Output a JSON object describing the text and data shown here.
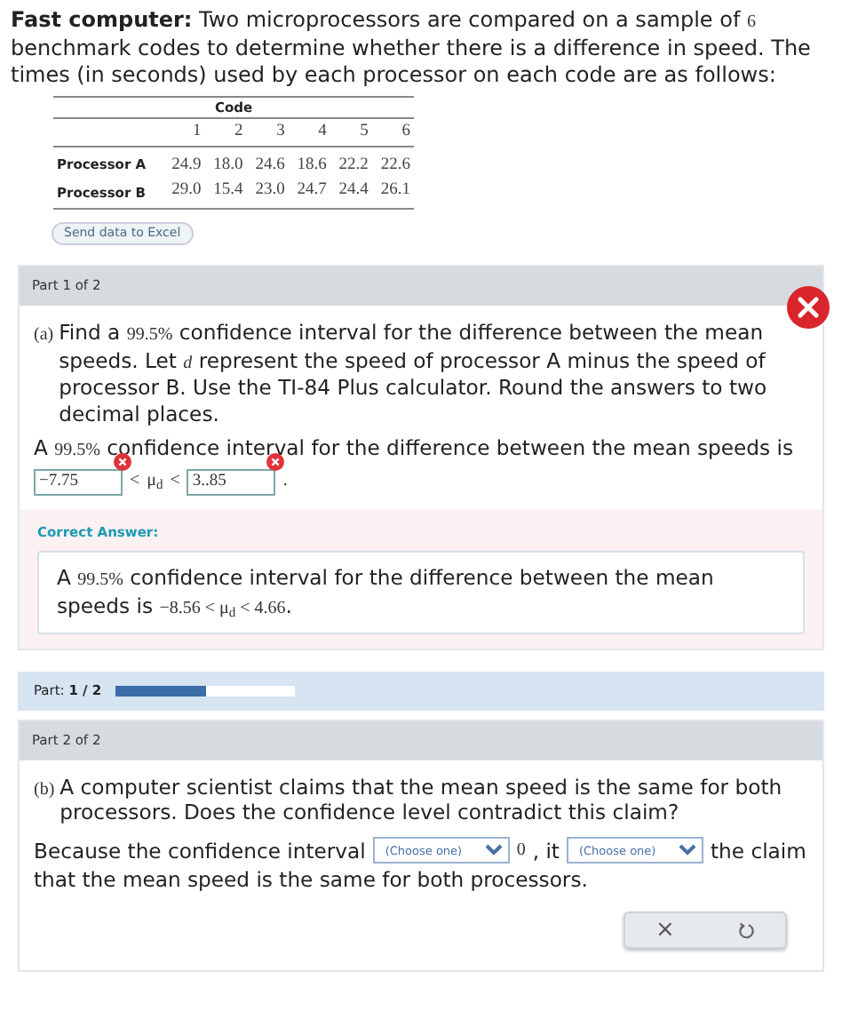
{
  "intro": [
    {
      "kind": "text",
      "text": "**Fast computer:** Two microprocessors are compared on a sample of "
    },
    {
      "kind": "math",
      "text": "6"
    },
    {
      "kind": "text",
      "text": " benchmark codes to determine whether there is a difference in speed. The times (in seconds) used by each processor on each code are as follows:"
    }
  ],
  "table": {
    "heading": "Code",
    "columns": [
      "1",
      "2",
      "3",
      "4",
      "5",
      "6"
    ],
    "rows": [
      {
        "label": "Processor A",
        "values": [
          "24.9",
          "18.0",
          "24.6",
          "18.6",
          "22.2",
          "22.6"
        ]
      },
      {
        "label": "Processor B",
        "values": [
          "29.0",
          "15.4",
          "23.0",
          "24.7",
          "24.4",
          "26.1"
        ]
      }
    ]
  },
  "excel_button": "Send data to Excel",
  "part1": {
    "header": "Part 1 of 2",
    "incorrect": true,
    "label": "(a)",
    "question": [
      {
        "kind": "text",
        "text": "Find a "
      },
      {
        "kind": "math",
        "text": "99.5%"
      },
      {
        "kind": "text",
        "text": " confidence interval for the difference between the mean speeds. Let "
      },
      {
        "kind": "math",
        "text": "*d*"
      },
      {
        "kind": "text",
        "text": " represent the speed of processor A minus the speed of processor B. Use the TI-84 Plus calculator. Round the answers to two decimal places."
      }
    ],
    "answer_intro": [
      {
        "kind": "text",
        "text": "A "
      },
      {
        "kind": "math",
        "text": "99.5%"
      },
      {
        "kind": "text",
        "text": " confidence interval for the difference between the mean speeds is"
      }
    ],
    "answer": [
      {
        "kind": "field",
        "value": "−7.75",
        "wrong": true
      },
      {
        "kind": "math",
        "text": "<"
      },
      {
        "kind": "math",
        "text": "μ$_{d}$"
      },
      {
        "kind": "math",
        "text": "<"
      },
      {
        "kind": "field",
        "value": "3..85",
        "wrong": true
      },
      {
        "kind": "math",
        "text": "."
      }
    ],
    "correct_label": "Correct Answer:",
    "correct": [
      {
        "kind": "text",
        "text": "A "
      },
      {
        "kind": "math",
        "text": "99.5%"
      },
      {
        "kind": "text",
        "text": " confidence interval for the difference between the mean speeds is "
      },
      {
        "kind": "math",
        "text": "−8.56 < μ$_{d}$ < 4.66"
      },
      {
        "kind": "text",
        "text": "."
      }
    ]
  },
  "progress": {
    "label": "Part:",
    "value": "1 / 2",
    "level": 0.5
  },
  "part2": {
    "header": "Part 2 of 2",
    "label": "(b)",
    "question": [
      {
        "kind": "text",
        "text": "A computer scientist claims that the mean speed is the same for both processors. Does the confidence level contradict this claim?"
      }
    ],
    "answer": [
      {
        "kind": "text",
        "text": "Because the confidence interval "
      },
      {
        "kind": "select",
        "placeholder": "(Choose one)"
      },
      {
        "kind": "math",
        "text": "0"
      },
      {
        "kind": "text",
        "text": ", it"
      },
      {
        "kind": "select",
        "placeholder": "(Choose one)"
      },
      {
        "kind": "text",
        "text": "the claim"
      },
      {
        "kind": "line",
        "text": "that the mean speed is the same for both processors."
      }
    ]
  },
  "tools": {
    "clear": "×"
  }
}
